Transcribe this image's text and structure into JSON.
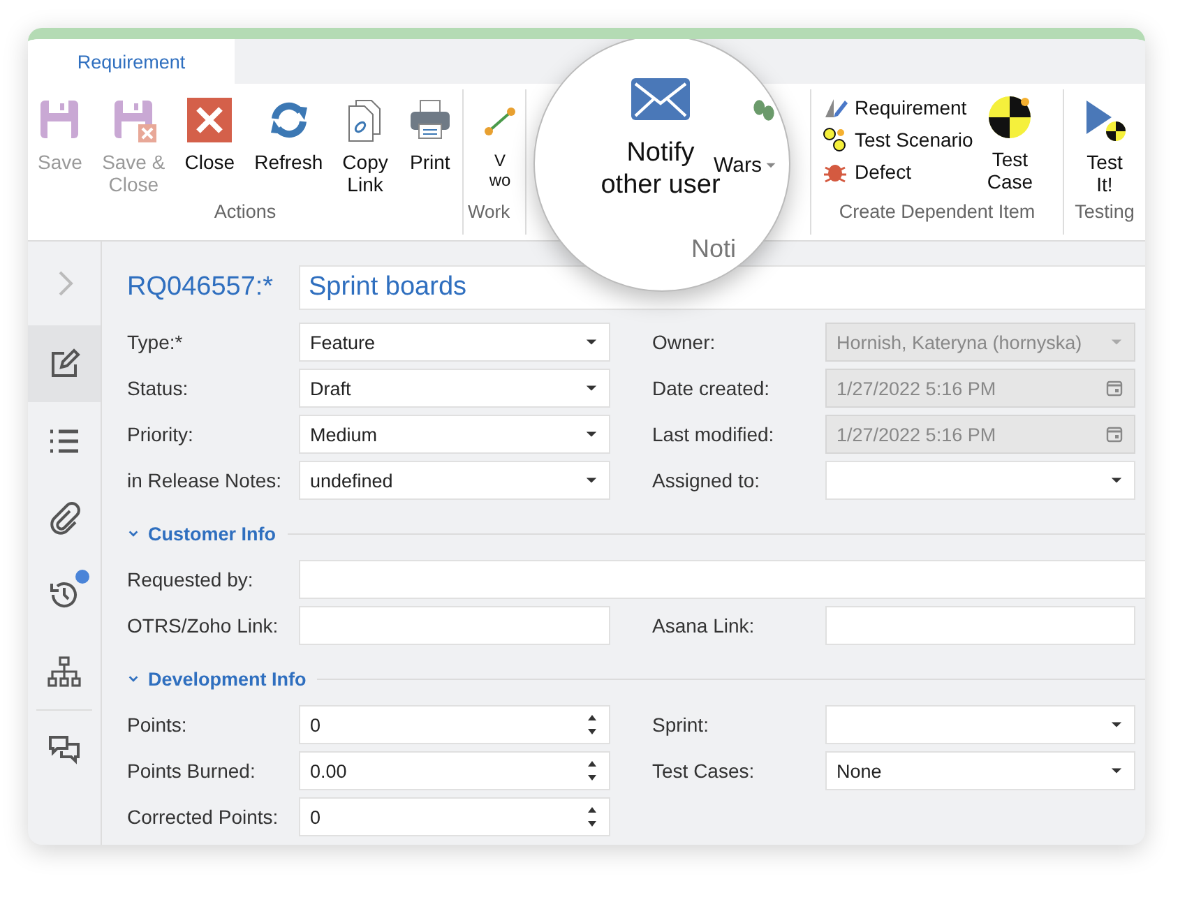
{
  "window": {
    "tab": {
      "label": "Requirement",
      "selected": true
    }
  },
  "ribbon": {
    "groups": [
      {
        "label": "Actions",
        "buttons": [
          {
            "label": "Save",
            "kind": "large",
            "disabled": true
          },
          {
            "label": "Save &\nClose",
            "kind": "large",
            "disabled": true
          },
          {
            "label": "Close",
            "kind": "large",
            "disabled": false
          },
          {
            "label": "Refresh",
            "kind": "large",
            "disabled": false
          },
          {
            "label": "Copy\nLink",
            "kind": "large",
            "disabled": false
          },
          {
            "label": "Print",
            "kind": "large",
            "disabled": false
          }
        ]
      },
      {
        "label": "Work",
        "buttons": [
          {
            "label": "V\nwo",
            "kind": "large",
            "disabled": false
          }
        ]
      },
      {
        "label": "Create Dependent Item",
        "buttons": [
          {
            "label": "Requirement",
            "kind": "small",
            "disabled": false
          },
          {
            "label": "Test Scenario",
            "kind": "small",
            "disabled": false
          },
          {
            "label": "Defect",
            "kind": "small",
            "disabled": false
          },
          {
            "label": "Test\nCase",
            "kind": "large",
            "disabled": false
          }
        ]
      },
      {
        "label": "Testing",
        "buttons": [
          {
            "label": "Test\nIt!",
            "kind": "large",
            "disabled": false
          }
        ]
      }
    ]
  },
  "magnifier": {
    "buttons": [
      {
        "label": "Notify\nother user"
      },
      {
        "label": "Wars"
      }
    ],
    "group_label": "Noti"
  },
  "sidebar": {
    "items": [
      {
        "selected": false,
        "badge": false
      },
      {
        "selected": true,
        "badge": false
      },
      {
        "selected": false,
        "badge": false
      },
      {
        "selected": false,
        "badge": false
      },
      {
        "selected": false,
        "badge": true
      },
      {
        "selected": false,
        "badge": false
      },
      {
        "selected": false,
        "badge": false
      }
    ]
  },
  "record": {
    "id": "RQ046557:*",
    "title": "Sprint boards"
  },
  "general": {
    "rows": [
      {
        "wide": false,
        "fields": [
          {
            "label": "Type:*",
            "kind": "select",
            "value": "Feature",
            "disabled": false
          },
          {
            "label": "Owner:",
            "kind": "select",
            "value": "Hornish, Kateryna (hornyska)",
            "disabled": true
          }
        ]
      },
      {
        "wide": false,
        "fields": [
          {
            "label": "Status:",
            "kind": "select",
            "value": "Draft",
            "disabled": false
          },
          {
            "label": "Date created:",
            "kind": "date",
            "value": "1/27/2022 5:16 PM",
            "disabled": true
          }
        ]
      },
      {
        "wide": false,
        "fields": [
          {
            "label": "Priority:",
            "kind": "select",
            "value": "Medium",
            "disabled": false
          },
          {
            "label": "Last modified:",
            "kind": "date",
            "value": "1/27/2022 5:16 PM",
            "disabled": true
          }
        ]
      },
      {
        "wide": false,
        "fields": [
          {
            "label": "in Release Notes:",
            "kind": "select",
            "value": "undefined",
            "disabled": false
          },
          {
            "label": "Assigned to:",
            "kind": "select",
            "disabled": false
          }
        ]
      }
    ]
  },
  "sections": [
    {
      "title": "Customer Info",
      "expanded": true,
      "rows": [
        {
          "wide": true,
          "fields": [
            {
              "label": "Requested by:",
              "kind": "text",
              "disabled": false
            }
          ]
        },
        {
          "wide": false,
          "fields": [
            {
              "label": "OTRS/Zoho Link:",
              "kind": "text",
              "disabled": false
            },
            {
              "label": "Asana Link:",
              "kind": "text",
              "disabled": false
            }
          ]
        }
      ]
    },
    {
      "title": "Development Info",
      "expanded": true,
      "rows": [
        {
          "wide": false,
          "fields": [
            {
              "label": "Points:",
              "kind": "number",
              "value": "0",
              "disabled": false
            },
            {
              "label": "Sprint:",
              "kind": "select",
              "disabled": false
            }
          ]
        },
        {
          "wide": false,
          "fields": [
            {
              "label": "Points Burned:",
              "kind": "number",
              "value": "0.00",
              "disabled": false
            },
            {
              "label": "Test Cases:",
              "kind": "select",
              "value": "None",
              "disabled": false
            }
          ]
        },
        {
          "wide": false,
          "fields": [
            {
              "label": "Corrected Points:",
              "kind": "number",
              "value": "0",
              "disabled": false
            }
          ]
        }
      ]
    }
  ]
}
